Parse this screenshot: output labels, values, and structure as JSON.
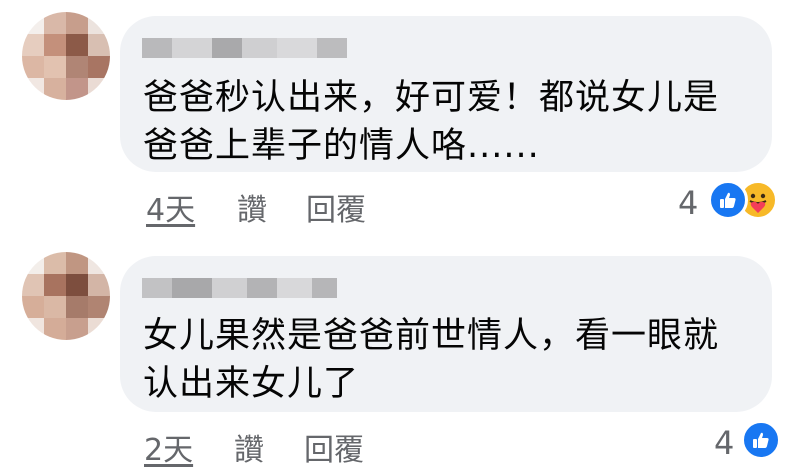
{
  "comments": [
    {
      "text_lines": [
        "爸爸秒认出来，好可爱！都说女儿是",
        "爸爸上辈子的情人咯......"
      ],
      "time": "4天",
      "like_label": "讚",
      "reply_label": "回覆",
      "reaction_count": "4",
      "reactions": [
        "like-icon",
        "care-icon"
      ]
    },
    {
      "text_lines": [
        "女儿果然是爸爸前世情人，看一眼就",
        "认出来女儿了"
      ],
      "time": "2天",
      "like_label": "讚",
      "reply_label": "回覆",
      "reaction_count": "4",
      "reactions": [
        "like-icon"
      ]
    }
  ],
  "colors": {
    "bubble": "#f0f2f5",
    "meta_text": "#65676b",
    "like_blue": "#1877f2",
    "care_yellow": "#f7b928"
  }
}
